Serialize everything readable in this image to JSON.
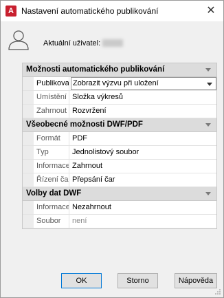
{
  "window": {
    "title": "Nastavení automatického publikování",
    "app_icon_letter": "A"
  },
  "user": {
    "label": "Aktuální uživatel:",
    "name_redacted": true
  },
  "categories": [
    {
      "label": "Možnosti automatického publikování",
      "props": [
        {
          "name": "Publikovat",
          "value": "Zobrazit výzvu při uložení",
          "dropdown": true,
          "selected": true
        },
        {
          "name": "Umístění",
          "value": "Složka výkresů"
        },
        {
          "name": "Zahrnout",
          "value": "Rozvržení"
        }
      ]
    },
    {
      "label": "Všeobecné možnosti DWF/PDF",
      "props": [
        {
          "name": "Formát",
          "value": "PDF"
        },
        {
          "name": "Typ",
          "value": "Jednolistový soubor"
        },
        {
          "name": "Informace",
          "value": "Zahrnout"
        },
        {
          "name": "Řízení čar",
          "value": "Přepsání čar"
        }
      ]
    },
    {
      "label": "Volby dat DWF",
      "props": [
        {
          "name": "Informace",
          "value": "Nezahrnout"
        },
        {
          "name": "Soubor",
          "value": "není",
          "disabled": true
        }
      ]
    }
  ],
  "buttons": {
    "ok": "OK",
    "cancel": "Storno",
    "help": "Nápověda"
  },
  "colors": {
    "accent": "#0078d7",
    "app_icon": "#c8202f",
    "category_bg": "#dcdcdc"
  }
}
